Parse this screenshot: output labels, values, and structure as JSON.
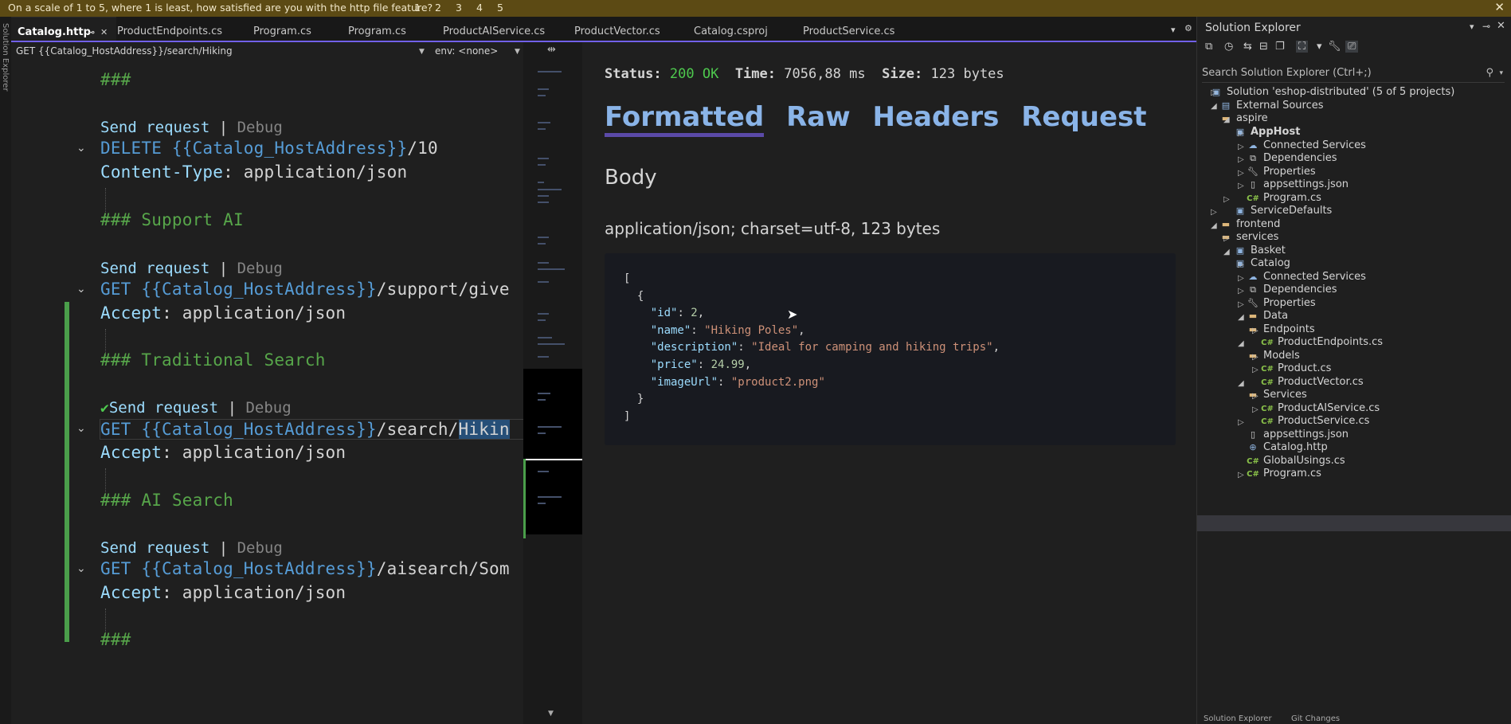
{
  "survey": {
    "question": "On a scale of 1 to 5, where 1 is least, how satisfied are you with the http file feature?",
    "options": [
      "1",
      "2",
      "3",
      "4",
      "5"
    ],
    "close": "✕"
  },
  "left_strip": {
    "label": "Solution Explorer"
  },
  "tabs": [
    {
      "label": "Catalog.http",
      "active": true
    },
    {
      "label": "ProductEndpoints.cs"
    },
    {
      "label": "Program.cs"
    },
    {
      "label": "Program.cs"
    },
    {
      "label": "ProductAIService.cs"
    },
    {
      "label": "ProductVector.cs"
    },
    {
      "label": "Catalog.csproj"
    },
    {
      "label": "ProductService.cs"
    }
  ],
  "navbar": {
    "request": "GET {{Catalog_HostAddress}}/search/Hiking",
    "env": "env: <none>"
  },
  "editor": {
    "l1": "###",
    "send": "Send request",
    "sep": " | ",
    "debug": "Debug",
    "delete_method": "DELETE",
    "delete_path": "/10",
    "host_var": "{{Catalog_HostAddress}}",
    "content_type_key": "Content-Type",
    "content_type_val": ": application/json",
    "support_ai": "### Support AI",
    "get": "GET",
    "support_path": "/support/give",
    "accept_key": "Accept",
    "accept_val": ": application/json",
    "traditional": "### Traditional Search",
    "search_path": "/search/",
    "search_sel": "Hikin",
    "ai_search": "### AI Search",
    "aisearch_path": "/aisearch/Som",
    "last": "###"
  },
  "response": {
    "status_label": "Status:",
    "status_value": "200 OK",
    "time_label": "Time:",
    "time_value": "7056,88 ms",
    "size_label": "Size:",
    "size_value": "123 bytes",
    "tabs": [
      "Formatted",
      "Raw",
      "Headers",
      "Request"
    ],
    "body_heading": "Body",
    "content_type": "application/json; charset=utf-8, 123 bytes",
    "json": {
      "open": "[",
      "obj_open": "{",
      "id_key": "\"id\"",
      "id_val": "2",
      "name_key": "\"name\"",
      "name_val": "\"Hiking Poles\"",
      "desc_key": "\"description\"",
      "desc_val": "\"Ideal for camping and hiking trips\"",
      "price_key": "\"price\"",
      "price_val": "24.99",
      "img_key": "\"imageUrl\"",
      "img_val": "\"product2.png\"",
      "obj_close": "}",
      "close": "]"
    }
  },
  "solution_explorer": {
    "title": "Solution Explorer",
    "search_placeholder": "Search Solution Explorer (Ctrl+;)",
    "items": [
      {
        "label": "Solution 'eshop-distributed' (5 of 5 projects)"
      },
      {
        "label": "External Sources"
      },
      {
        "label": "aspire"
      },
      {
        "label": "AppHost"
      },
      {
        "label": "Connected Services"
      },
      {
        "label": "Dependencies"
      },
      {
        "label": "Properties"
      },
      {
        "label": "appsettings.json"
      },
      {
        "label": "Program.cs"
      },
      {
        "label": "ServiceDefaults"
      },
      {
        "label": "frontend"
      },
      {
        "label": "services"
      },
      {
        "label": "Basket"
      },
      {
        "label": "Catalog"
      },
      {
        "label": "Connected Services"
      },
      {
        "label": "Dependencies"
      },
      {
        "label": "Properties"
      },
      {
        "label": "Data"
      },
      {
        "label": "Endpoints"
      },
      {
        "label": "ProductEndpoints.cs"
      },
      {
        "label": "Models"
      },
      {
        "label": "Product.cs"
      },
      {
        "label": "ProductVector.cs"
      },
      {
        "label": "Services"
      },
      {
        "label": "ProductAIService.cs"
      },
      {
        "label": "ProductService.cs"
      },
      {
        "label": "appsettings.json"
      },
      {
        "label": "Catalog.http"
      },
      {
        "label": "GlobalUsings.cs"
      },
      {
        "label": "Program.cs"
      }
    ],
    "bottom_tabs": [
      "Solution Explorer",
      "Git Changes"
    ]
  },
  "colors": {
    "accent": "#7160e8",
    "ok": "#4ec94e",
    "comment": "#57a64a",
    "keyword": "#569cd6"
  }
}
